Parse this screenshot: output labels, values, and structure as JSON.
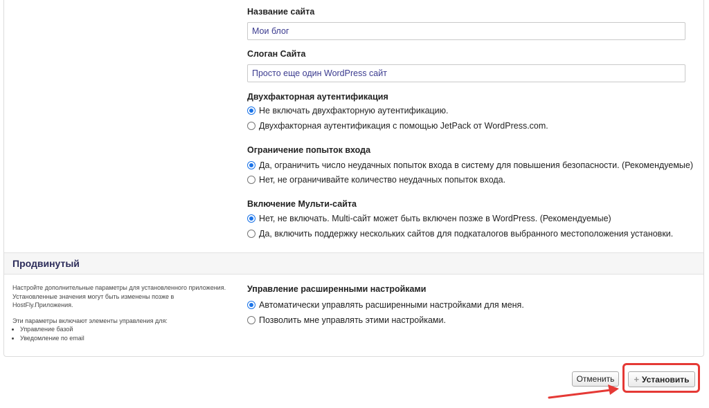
{
  "site_name": {
    "label": "Название сайта",
    "value": "Мои блог"
  },
  "site_slogan": {
    "label": "Слоган Сайта",
    "value": "Просто еще один WordPress сайт"
  },
  "two_factor": {
    "label": "Двухфакторная аутентификация",
    "options": [
      {
        "label": "Не включать двухфакторную аутентификацию.",
        "checked": true
      },
      {
        "label": "Двухфакторная аутентификация с помощью JetPack от WordPress.com.",
        "checked": false
      }
    ]
  },
  "login_limit": {
    "label": "Ограничение попыток входа",
    "options": [
      {
        "label": "Да, ограничить число неудачных попыток входа в систему для повышения безопасности. (Рекомендуемые)",
        "checked": true
      },
      {
        "label": "Нет, не ограничивайте количество неудачных попыток входа.",
        "checked": false
      }
    ]
  },
  "multisite": {
    "label": "Включение Мульти-сайта",
    "options": [
      {
        "label": "Нет, не включать. Multi-сайт может быть включен позже в WordPress. (Рекомендуемые)",
        "checked": true
      },
      {
        "label": "Да, включить поддержку нескольких сайтов для подкаталогов выбранного местоположения установки.",
        "checked": false
      }
    ]
  },
  "advanced": {
    "title": "Продвинутый",
    "description": "Настройте дополнительные параметры для установленного приложения. Установленные значения могут быть изменены позже в HostFly.Приложения.",
    "controls_intro": "Эти параметры включают элементы управления для:",
    "controls": [
      "Управление базой",
      "Уведомление по email"
    ],
    "manage_label": "Управление расширенными настройками",
    "options": [
      {
        "label": "Автоматически управлять расширенными настройками для меня.",
        "checked": true
      },
      {
        "label": "Позволить мне управлять этими настройками.",
        "checked": false
      }
    ]
  },
  "buttons": {
    "cancel": "Отменить",
    "install": "Установить",
    "install_icon": "plus-icon"
  },
  "colors": {
    "accent": "#1a73e8",
    "highlight": "#e53935"
  }
}
